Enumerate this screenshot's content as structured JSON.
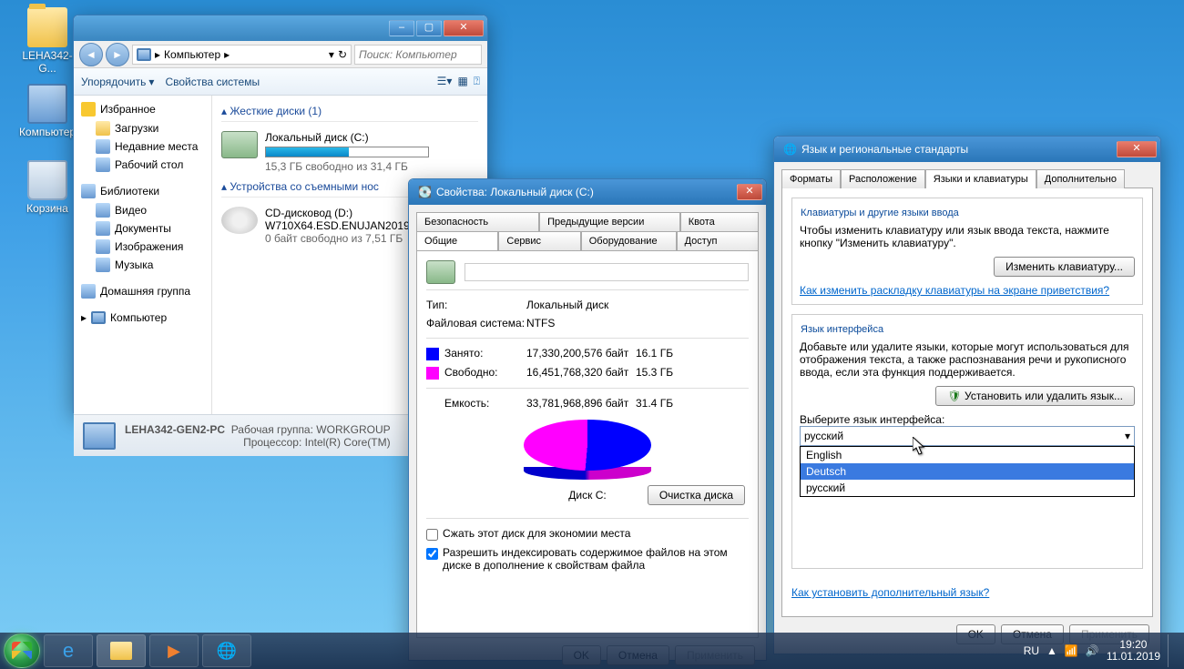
{
  "desktop": {
    "icons": [
      "LEHA342-G...",
      "Компьютер",
      "Корзина"
    ]
  },
  "explorer": {
    "breadcrumb_root": "Компьютер",
    "search_placeholder": "Поиск: Компьютер",
    "toolbar": {
      "organize": "Упорядочить",
      "sysprops": "Свойства системы"
    },
    "nav": {
      "favorites": "Избранное",
      "fav_items": [
        "Загрузки",
        "Недавние места",
        "Рабочий стол"
      ],
      "libraries": "Библиотеки",
      "lib_items": [
        "Видео",
        "Документы",
        "Изображения",
        "Музыка"
      ],
      "homegroup": "Домашняя группа",
      "computer": "Компьютер"
    },
    "sections": {
      "hdd": "Жесткие диски (1)",
      "removable": "Устройства со съемными нос"
    },
    "drive_c": {
      "name": "Локальный диск (C:)",
      "free": "15,3 ГБ свободно из 31,4 ГБ",
      "fill_pct": 51
    },
    "drive_d": {
      "name": "CD-дисковод (D:)",
      "label": "W710X64.ESD.ENUJAN2019",
      "free": "0 байт свободно из 7,51 ГБ"
    },
    "details": {
      "pc": "LEHA342-GEN2-PC",
      "wg_label": "Рабочая группа:",
      "wg": "WORKGROUP",
      "cpu_label": "Процессор:",
      "cpu": "Intel(R) Core(TM)"
    }
  },
  "props": {
    "title": "Свойства: Локальный диск (C:)",
    "tabs_top": [
      "Безопасность",
      "Предыдущие версии",
      "Квота"
    ],
    "tabs_bot": [
      "Общие",
      "Сервис",
      "Оборудование",
      "Доступ"
    ],
    "type_label": "Тип:",
    "type_val": "Локальный диск",
    "fs_label": "Файловая система:",
    "fs_val": "NTFS",
    "used_label": "Занято:",
    "used_bytes": "17,330,200,576 байт",
    "used_gb": "16.1 ГБ",
    "free_label": "Свободно:",
    "free_bytes": "16,451,768,320 байт",
    "free_gb": "15.3 ГБ",
    "cap_label": "Емкость:",
    "cap_bytes": "33,781,968,896 байт",
    "cap_gb": "31.4 ГБ",
    "pie_label": "Диск C:",
    "cleanup": "Очистка диска",
    "compress": "Сжать этот диск для экономии места",
    "index": "Разрешить индексировать содержимое файлов на этом диске в дополнение к свойствам файла",
    "ok": "OK",
    "cancel": "Отмена",
    "apply": "Применить"
  },
  "lang": {
    "title": "Язык и региональные стандарты",
    "tabs": [
      "Форматы",
      "Расположение",
      "Языки и клавиатуры",
      "Дополнительно"
    ],
    "kbd_group": "Клавиатуры и другие языки ввода",
    "kbd_desc": "Чтобы изменить клавиатуру или язык ввода текста, нажмите кнопку \"Изменить клавиатуру\".",
    "kbd_btn": "Изменить клавиатуру...",
    "kbd_link": "Как изменить раскладку клавиатуры на экране приветствия?",
    "ui_group": "Язык интерфейса",
    "ui_desc": "Добавьте или удалите языки, которые могут использоваться для отображения текста, а также распознавания речи и рукописного ввода, если эта функция поддерживается.",
    "install_btn": "Установить или удалить язык...",
    "select_label": "Выберите язык интерфейса:",
    "selected": "русский",
    "options": [
      "English",
      "Deutsch",
      "русский"
    ],
    "help_link": "Как установить дополнительный язык?",
    "ok": "OK",
    "cancel": "Отмена",
    "apply": "Применить"
  },
  "taskbar": {
    "lang": "RU",
    "time": "19:20",
    "date": "11.01.2019"
  },
  "chart_data": {
    "type": "pie",
    "title": "Диск C:",
    "series": [
      {
        "name": "Занято",
        "value": 17330200576,
        "display": "16.1 ГБ",
        "color": "#0000ff"
      },
      {
        "name": "Свободно",
        "value": 16451768320,
        "display": "15.3 ГБ",
        "color": "#ff00ff"
      }
    ],
    "total": {
      "name": "Емкость",
      "value": 33781968896,
      "display": "31.4 ГБ"
    }
  }
}
